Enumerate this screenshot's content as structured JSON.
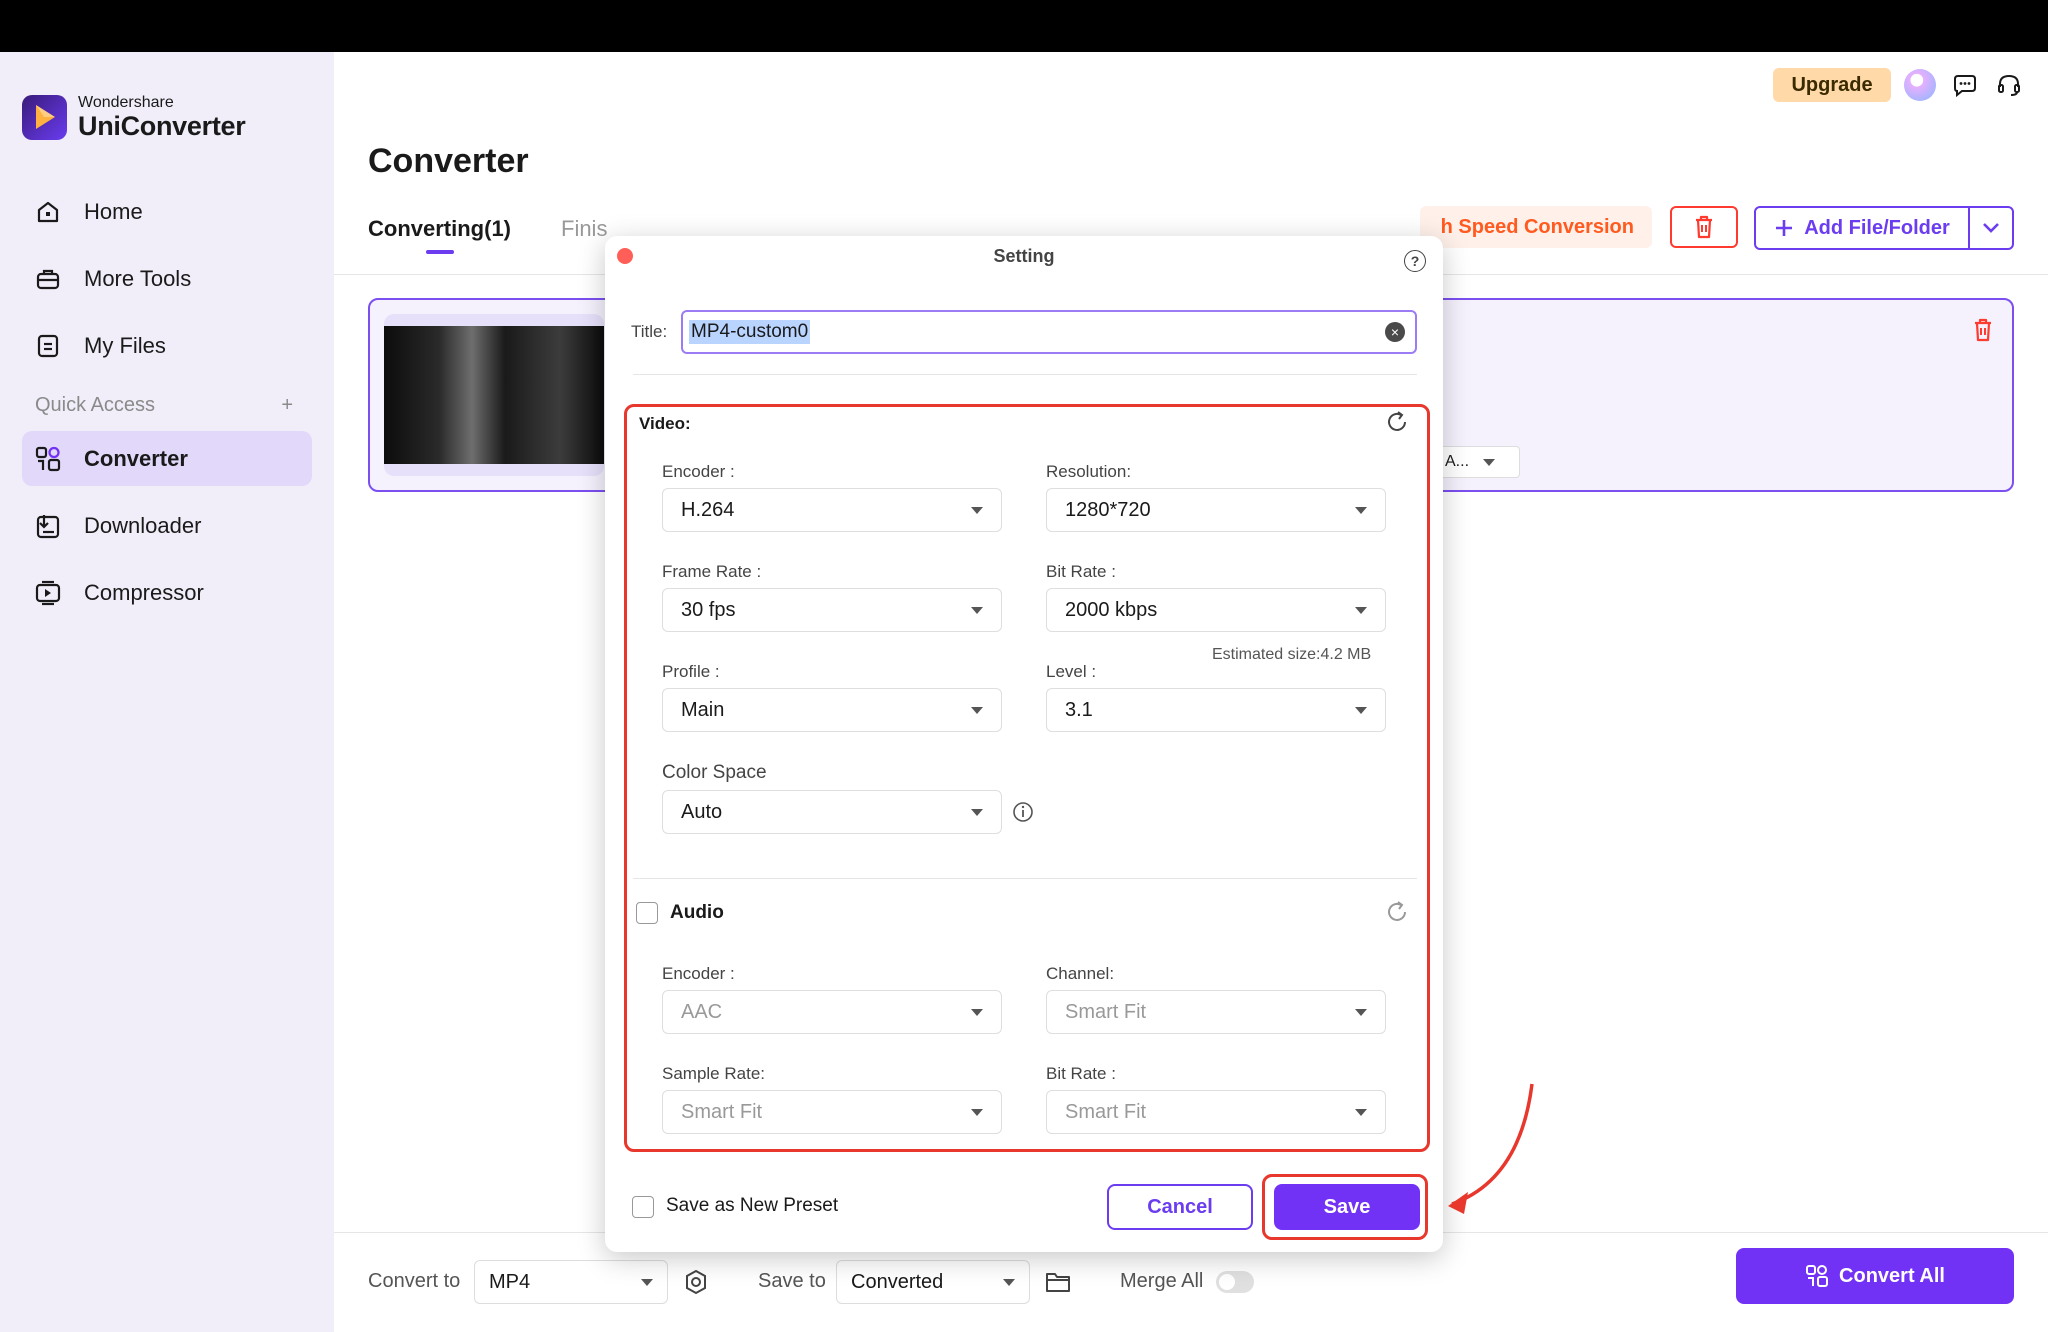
{
  "app": {
    "brand_small": "Wondershare",
    "brand_name": "UniConverter",
    "accent": "#7232f5",
    "highlight": "#e8372c"
  },
  "sidebar": {
    "items": [
      {
        "label": "Home",
        "icon": "home-icon"
      },
      {
        "label": "More Tools",
        "icon": "toolbox-icon"
      },
      {
        "label": "My Files",
        "icon": "files-icon"
      }
    ],
    "quick_access_label": "Quick Access",
    "quick_access_add": "+",
    "quick_items": [
      {
        "label": "Converter",
        "icon": "converter-icon",
        "active": true
      },
      {
        "label": "Downloader",
        "icon": "downloader-icon"
      },
      {
        "label": "Compressor",
        "icon": "compressor-icon"
      }
    ]
  },
  "header": {
    "upgrade_label": "Upgrade",
    "icons": [
      "avatar",
      "message-icon",
      "headset-icon"
    ]
  },
  "main": {
    "title": "Converter",
    "tabs": [
      {
        "label": "Converting(1)",
        "active": true
      },
      {
        "label": "Finis"
      }
    ],
    "high_speed_label": "h Speed Conversion",
    "add_file_label": "Add File/Folder",
    "card_dropdown_label": "A..."
  },
  "bottom": {
    "convert_to_label": "Convert to",
    "convert_to_value": "MP4",
    "save_to_label": "Save to",
    "save_to_value": "Converted",
    "merge_all_label": "Merge All",
    "merge_all_on": false,
    "convert_all_label": "Convert All"
  },
  "dialog": {
    "title": "Setting",
    "help": "?",
    "title_label": "Title:",
    "title_value": "MP4-custom0",
    "video": {
      "heading": "Video:",
      "encoder_label": "Encoder :",
      "encoder_value": "H.264",
      "resolution_label": "Resolution:",
      "resolution_value": "1280*720",
      "frame_rate_label": "Frame Rate :",
      "frame_rate_value": "30 fps",
      "bit_rate_label": "Bit Rate :",
      "bit_rate_value": "2000 kbps",
      "estimated_size": "Estimated size:4.2 MB",
      "profile_label": "Profile :",
      "profile_value": "Main",
      "level_label": "Level :",
      "level_value": "3.1",
      "color_space_label": "Color Space",
      "color_space_value": "Auto"
    },
    "audio": {
      "heading": "Audio",
      "enabled": false,
      "encoder_label": "Encoder :",
      "encoder_value": "AAC",
      "channel_label": "Channel:",
      "channel_value": "Smart Fit",
      "sample_rate_label": "Sample Rate:",
      "sample_rate_value": "Smart Fit",
      "bit_rate_label": "Bit Rate :",
      "bit_rate_value": "Smart Fit"
    },
    "save_preset_label": "Save as New Preset",
    "cancel_label": "Cancel",
    "save_label": "Save"
  }
}
